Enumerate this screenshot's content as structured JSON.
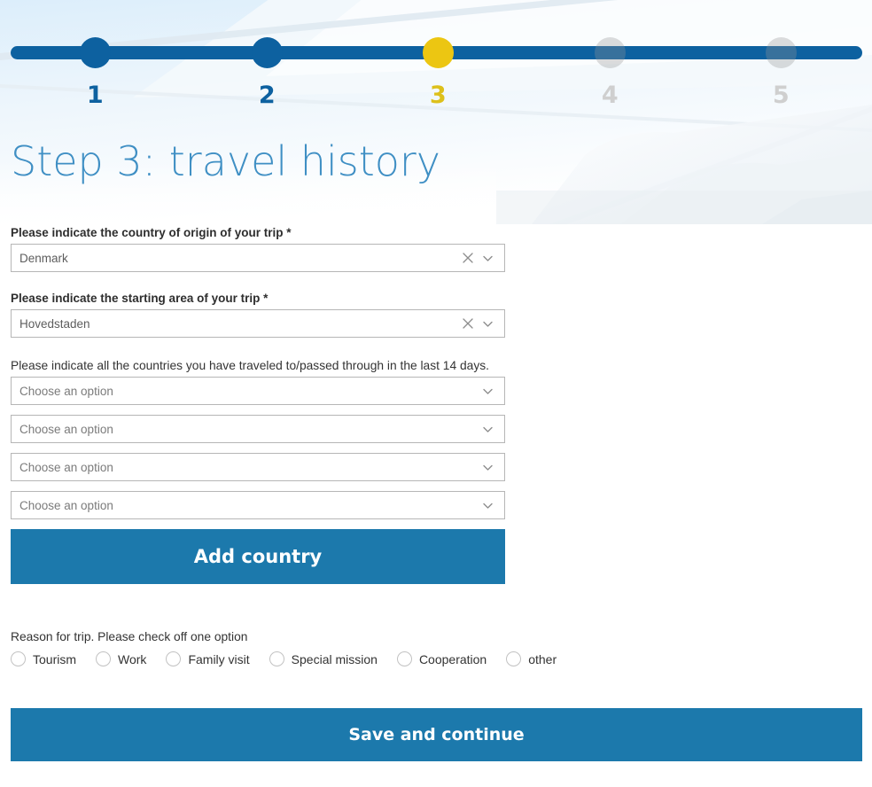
{
  "stepper": {
    "steps": [
      {
        "number": "1",
        "state": "done"
      },
      {
        "number": "2",
        "state": "done"
      },
      {
        "number": "3",
        "state": "current"
      },
      {
        "number": "4",
        "state": "todo"
      },
      {
        "number": "5",
        "state": "todo"
      }
    ],
    "colors": {
      "done": "#0d61a0",
      "current": "#ecc612",
      "todo": "#c9c9c9",
      "track": "#0d61a0"
    }
  },
  "header": {
    "title": "Step 3: travel history",
    "title_color": "#3f8fc4"
  },
  "form": {
    "country_of_origin": {
      "label": "Please indicate the country of origin of your trip *",
      "value": "Denmark",
      "clear_icon": "close-x-icon",
      "chevron_icon": "chevron-down-icon"
    },
    "starting_area": {
      "label": "Please indicate the starting area of your trip *",
      "value": "Hovedstaden",
      "clear_icon": "close-x-icon",
      "chevron_icon": "chevron-down-icon"
    },
    "traveled_countries": {
      "label": "Please indicate all the countries you have traveled to/passed through in the last 14 days.",
      "placeholder": "Choose an option",
      "selects": [
        {
          "value": "Choose an option"
        },
        {
          "value": "Choose an option"
        },
        {
          "value": "Choose an option"
        },
        {
          "value": "Choose an option"
        }
      ]
    },
    "add_country_button": {
      "label": "Add country",
      "color": "#1c79ac"
    },
    "reason": {
      "label": "Reason for trip. Please check off one option",
      "options": [
        {
          "label": "Tourism",
          "selected": false
        },
        {
          "label": "Work",
          "selected": false
        },
        {
          "label": "Family visit",
          "selected": false
        },
        {
          "label": "Special mission",
          "selected": false
        },
        {
          "label": "Cooperation",
          "selected": false
        },
        {
          "label": "other",
          "selected": false
        }
      ]
    },
    "save_button": {
      "label": "Save and continue",
      "color": "#1c79ac"
    }
  }
}
